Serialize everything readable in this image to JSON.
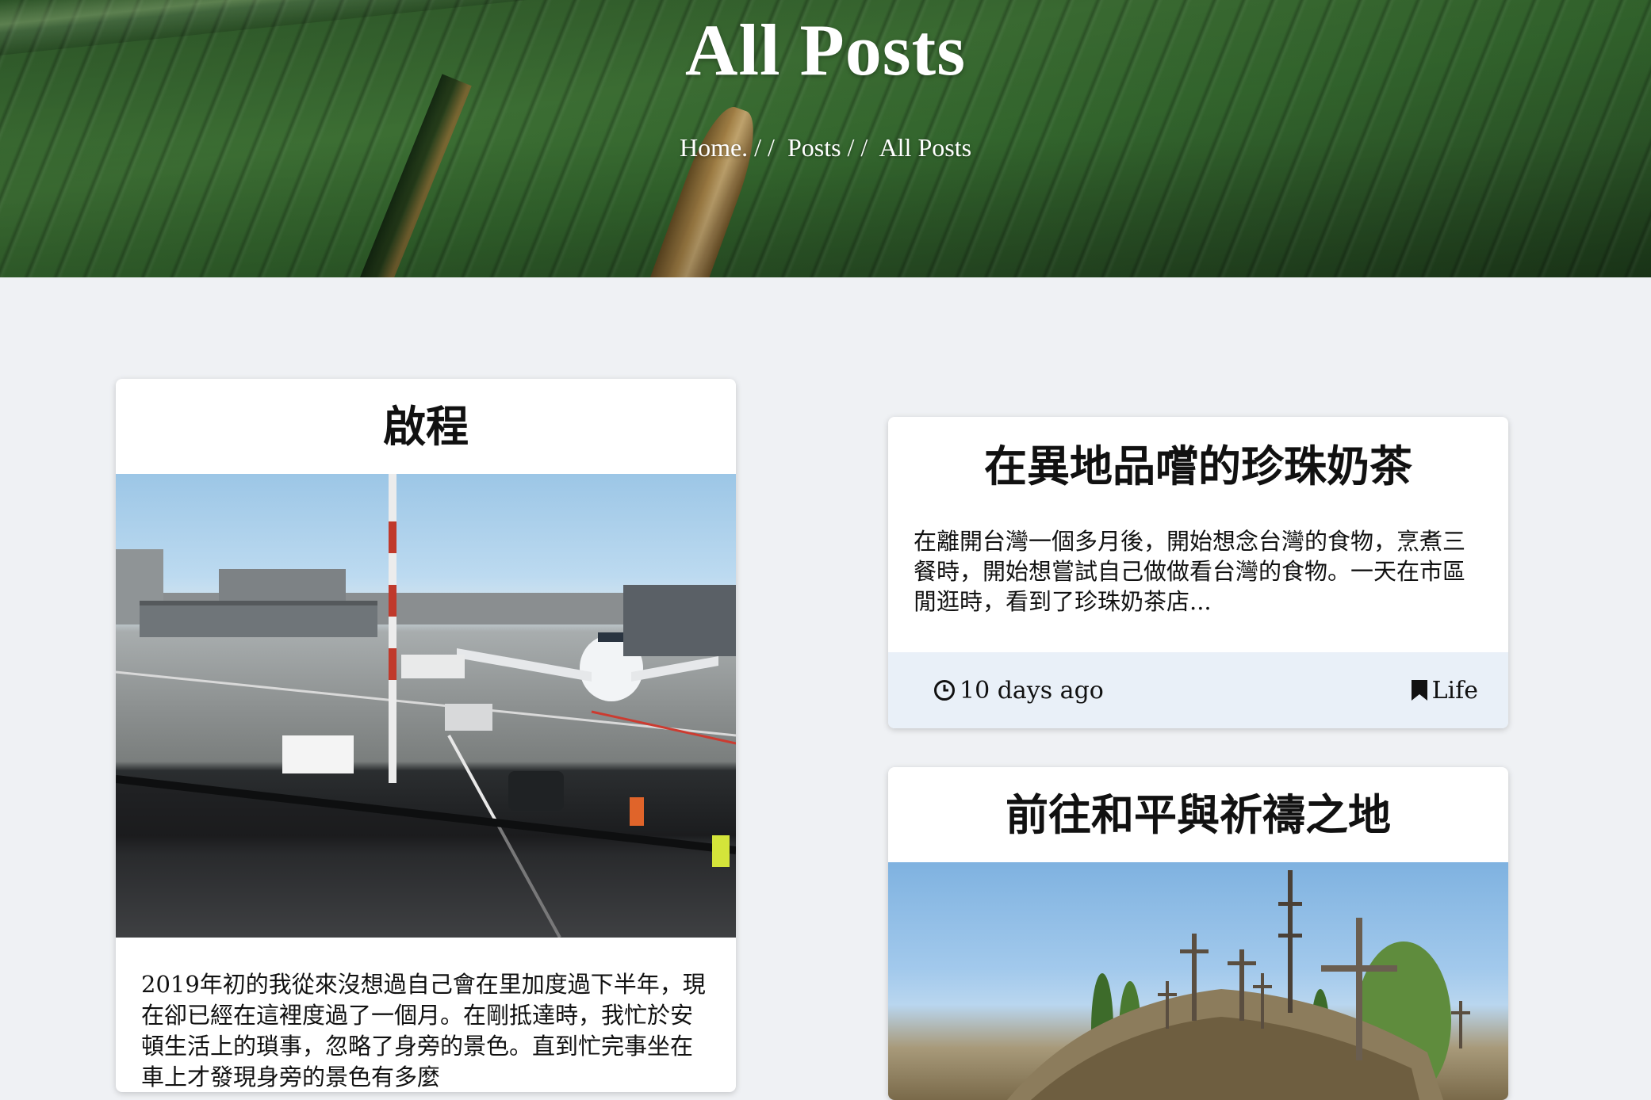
{
  "hero": {
    "title": "All Posts",
    "breadcrumb": {
      "home": "Home.",
      "sep1": " / /  ",
      "posts": "Posts",
      "sep2": " / /  ",
      "current": "All Posts"
    }
  },
  "posts": [
    {
      "title": "啟程",
      "image": "airport-tarmac-photo",
      "excerpt": "2019年初的我從來沒想過自己會在里加度過下半年，現在卻已經在這裡度過了一個月。在剛抵達時，我忙於安頓生活上的瑣事，忽略了身旁的景色。直到忙完事坐在車上才發現身旁的景色有多麼"
    },
    {
      "title": "在異地品嚐的珍珠奶茶",
      "excerpt": "在離開台灣一個多月後，開始想念台灣的食物，烹煮三餐時，開始想嘗試自己做做看台灣的食物。一天在市區閒逛時，看到了珍珠奶茶店...",
      "time": "10 days ago",
      "time_icon": "clock-icon",
      "category": "Life",
      "category_icon": "bookmark-icon"
    },
    {
      "title": "前往和平與祈禱之地",
      "image": "hill-of-crosses-photo"
    }
  ],
  "colors": {
    "page_bg": "#eff1f4",
    "card_bg": "#ffffff",
    "footer_bg": "#e9f0f8",
    "hero_text": "#ffffff"
  }
}
